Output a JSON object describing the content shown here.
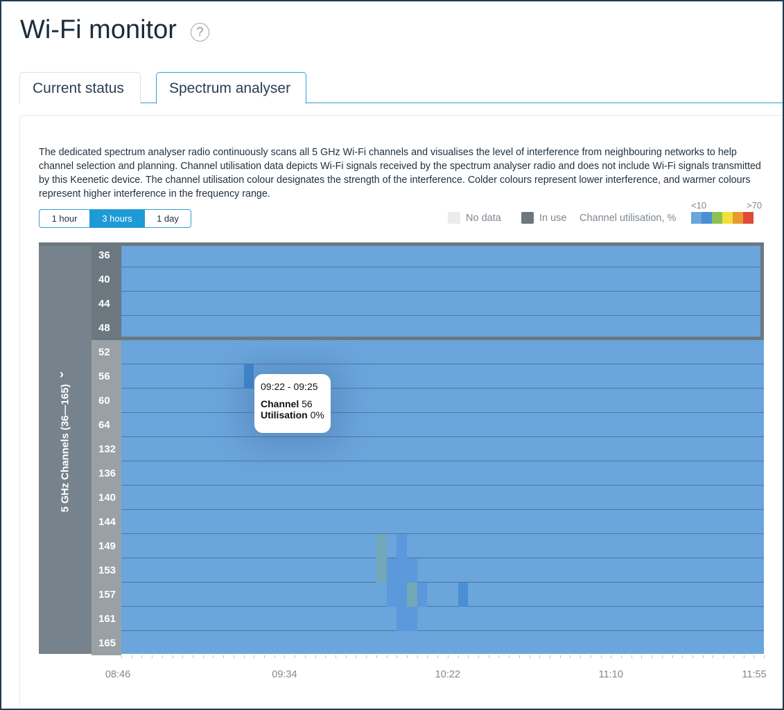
{
  "page": {
    "title": "Wi-Fi monitor",
    "help_icon": "?"
  },
  "tabs": [
    {
      "label": "Current status",
      "active": false
    },
    {
      "label": "Spectrum analyser",
      "active": true
    }
  ],
  "description": "The dedicated spectrum analyser radio continuously scans all 5 GHz Wi-Fi channels and visualises the level of interference from neighbouring networks to help channel selection and planning. Channel utilisation data depicts Wi-Fi signals received by the spectrum analyser radio and does not include Wi-Fi signals transmitted by this Keenetic device. The channel utilisation colour designates the strength of the interference. Colder colours represent lower interference, and warmer colours represent higher interference in the frequency range.",
  "periods": [
    {
      "label": "1 hour",
      "active": false
    },
    {
      "label": "3 hours",
      "active": true
    },
    {
      "label": "1 day",
      "active": false
    }
  ],
  "legend": {
    "no_data": "No data",
    "in_use": "In use",
    "utilisation": "Channel utilisation, %",
    "scale_min": "<10",
    "scale_max": ">70",
    "scale_colors": [
      "#6aa5dc",
      "#4a8fd4",
      "#8cc152",
      "#f2e03a",
      "#e89a2f",
      "#e0483a"
    ],
    "no_data_color": "#ececec",
    "in_use_color": "#6b7880"
  },
  "chart": {
    "side_label": "5 GHz Channels (36—165)",
    "channels": [
      "36",
      "40",
      "44",
      "48",
      "52",
      "56",
      "60",
      "64",
      "132",
      "136",
      "140",
      "144",
      "149",
      "153",
      "157",
      "161",
      "165"
    ],
    "in_use_channels": [
      "36",
      "40",
      "44",
      "48"
    ],
    "time_labels": [
      "08:46",
      "09:34",
      "10:22",
      "11:10",
      "11:55"
    ],
    "base_color": "#6aa5dc",
    "highlights": [
      {
        "channel": "56",
        "time": "09:22",
        "color": "#3f86d1"
      },
      {
        "channel": "149",
        "time": "10:01",
        "color": "#72a8b8"
      },
      {
        "channel": "149",
        "time": "10:07",
        "color": "#5b99dc"
      },
      {
        "channel": "153",
        "time": "10:01",
        "color": "#72a8b8"
      },
      {
        "channel": "153",
        "time": "10:04",
        "color": "#5b99dc"
      },
      {
        "channel": "153",
        "time": "10:07",
        "color": "#5b99dc"
      },
      {
        "channel": "153",
        "time": "10:10",
        "color": "#5b99dc"
      },
      {
        "channel": "157",
        "time": "10:04",
        "color": "#5b99dc"
      },
      {
        "channel": "157",
        "time": "10:07",
        "color": "#5b99dc"
      },
      {
        "channel": "157",
        "time": "10:10",
        "color": "#72a8b8"
      },
      {
        "channel": "157",
        "time": "10:13",
        "color": "#5b99dc"
      },
      {
        "channel": "157",
        "time": "10:25",
        "color": "#4a8fd4"
      },
      {
        "channel": "161",
        "time": "10:07",
        "color": "#5b99dc"
      },
      {
        "channel": "161",
        "time": "10:10",
        "color": "#5b99dc"
      }
    ]
  },
  "tooltip": {
    "time": "09:22 - 09:25",
    "channel_label": "Channel",
    "channel_value": "56",
    "utilisation_label": "Utilisation",
    "utilisation_value": "0%"
  }
}
